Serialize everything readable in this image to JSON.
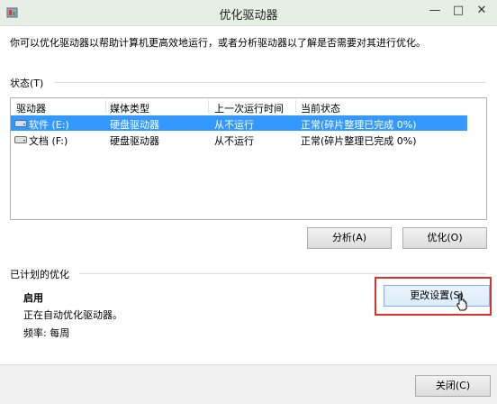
{
  "window": {
    "title": "优化驱动器",
    "minimize_glyph": "—",
    "maximize_glyph": "□",
    "close_glyph": "✕"
  },
  "description": "你可以优化驱动器以帮助计算机更高效地运行，或者分析驱动器以了解是否需要对其进行优化。",
  "status_group": {
    "label": "状态(T)",
    "columns": [
      "驱动器",
      "媒体类型",
      "上一次运行时间",
      "当前状态"
    ],
    "rows": [
      {
        "drive": "软件 (E:)",
        "media": "硬盘驱动器",
        "last_run": "从不运行",
        "status": "正常(碎片整理已完成 0%)",
        "selected": true
      },
      {
        "drive": "文档 (F:)",
        "media": "硬盘驱动器",
        "last_run": "从不运行",
        "status": "正常(碎片整理已完成 0%)",
        "selected": false
      }
    ],
    "analyze_button": "分析(A)",
    "optimize_button": "优化(O)"
  },
  "schedule_group": {
    "label": "已计划的优化",
    "state": "启用",
    "detail": "正在自动优化驱动器。",
    "frequency": "频率: 每周",
    "change_settings_button": "更改设置(S)"
  },
  "footer": {
    "close_button": "关闭(C)"
  },
  "colors": {
    "selection": "#3399ff",
    "highlight_box": "#e0302d",
    "titlebar": "#e6eee5"
  }
}
